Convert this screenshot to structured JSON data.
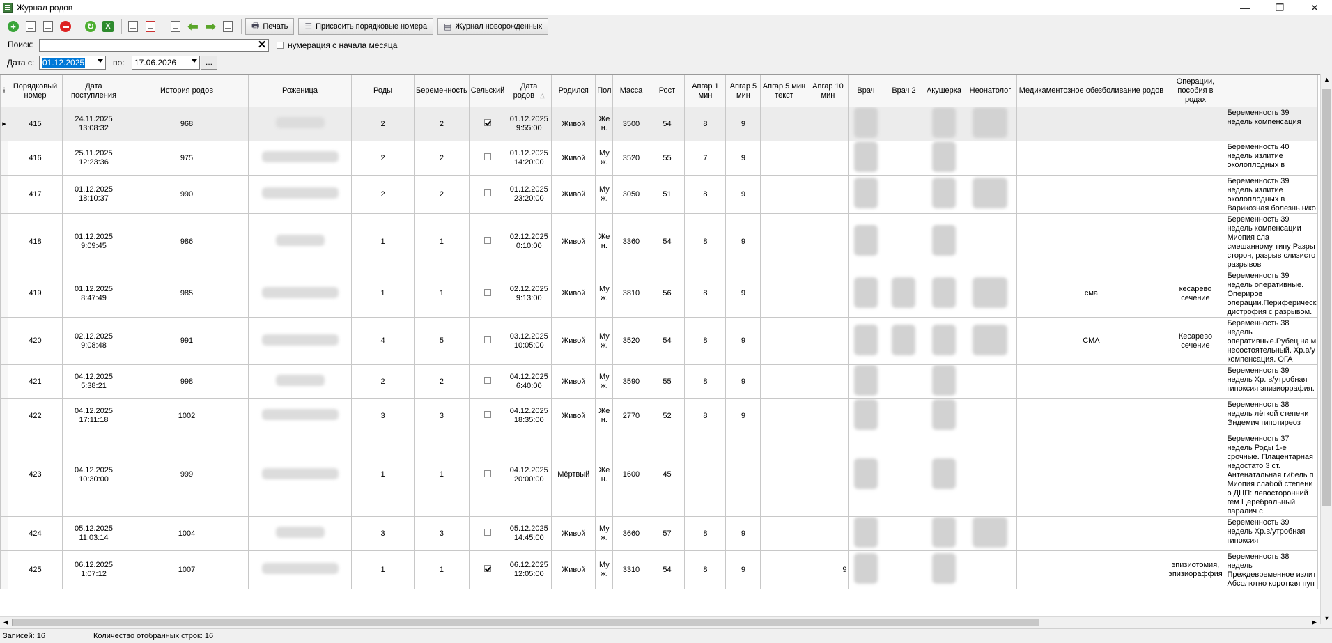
{
  "window": {
    "title": "Журнал родов",
    "minimize": "—",
    "restore": "❐",
    "close": "✕"
  },
  "toolbar": {
    "print_label": "Печать",
    "assign_numbers_label": "Присвоить порядковые номера",
    "newborn_journal_label": "Журнал новорожденных"
  },
  "search": {
    "label": "Поиск:",
    "value": "",
    "clear": "✕"
  },
  "numbering_option": {
    "label": "нумерация с начала месяца",
    "checked": false
  },
  "dates": {
    "from_label": "Дата с:",
    "from_value": "01.12.2025",
    "to_label": "по:",
    "to_value": "17.06.2026",
    "more": "..."
  },
  "columns": [
    "Порядковый номер",
    "Дата поступления",
    "История родов",
    "Роженица",
    "Роды",
    "Беременность",
    "Сельский",
    "Дата родов",
    "Родился",
    "Пол",
    "Масса",
    "Рост",
    "Апгар 1 мин",
    "Апгар 5 мин",
    "Апгар 5 мин текст",
    "Апгар 10 мин",
    "Врач",
    "Врач 2",
    "Акушерка",
    "Неонатолог",
    "Медикаментозное обезболивание родов",
    "Операции, пособия в родах",
    ""
  ],
  "rows": [
    {
      "num": "415",
      "adm": "24.11.2025 13:08:32",
      "hist": "968",
      "births": "2",
      "preg": "2",
      "rural": true,
      "bdate": "01.12.2025 9:55:00",
      "born": "Живой",
      "sex": "Же н.",
      "mass": "3500",
      "height": "54",
      "a1": "8",
      "a5": "9",
      "a10": "",
      "anest": "",
      "ops": "",
      "diag": "Беременность 39 недель компенсация"
    },
    {
      "num": "416",
      "adm": "25.11.2025 12:23:36",
      "hist": "975",
      "births": "2",
      "preg": "2",
      "rural": false,
      "bdate": "01.12.2025 14:20:00",
      "born": "Живой",
      "sex": "Му ж.",
      "mass": "3520",
      "height": "55",
      "a1": "7",
      "a5": "9",
      "a10": "",
      "anest": "",
      "ops": "",
      "diag": "Беременность 40 недель излитие околоплодных в"
    },
    {
      "num": "417",
      "adm": "01.12.2025 18:10:37",
      "hist": "990",
      "births": "2",
      "preg": "2",
      "rural": false,
      "bdate": "01.12.2025 23:20:00",
      "born": "Живой",
      "sex": "Му ж.",
      "mass": "3050",
      "height": "51",
      "a1": "8",
      "a5": "9",
      "a10": "",
      "anest": "",
      "ops": "",
      "diag": "Беременность 39 недель излитие околоплодных в Варикозная болезнь н/ко"
    },
    {
      "num": "418",
      "adm": "01.12.2025 9:09:45",
      "hist": "986",
      "births": "1",
      "preg": "1",
      "rural": false,
      "bdate": "02.12.2025 0:10:00",
      "born": "Живой",
      "sex": "Же н.",
      "mass": "3360",
      "height": "54",
      "a1": "8",
      "a5": "9",
      "a10": "",
      "anest": "",
      "ops": "",
      "diag": "Беременность 39 недель компенсации Миопия сла смешанному типу Разры сторон, разрыв слизисто разрывов"
    },
    {
      "num": "419",
      "adm": "01.12.2025 8:47:49",
      "hist": "985",
      "births": "1",
      "preg": "1",
      "rural": false,
      "bdate": "02.12.2025 9:13:00",
      "born": "Живой",
      "sex": "Му ж.",
      "mass": "3810",
      "height": "56",
      "a1": "8",
      "a5": "9",
      "a10": "",
      "anest": "сма",
      "ops": "кесарево сечение",
      "diag": "Беременность 39 недель оперативные. Опериров операции.Периферическ дистрофия с разрывом."
    },
    {
      "num": "420",
      "adm": "02.12.2025 9:08:48",
      "hist": "991",
      "births": "4",
      "preg": "5",
      "rural": false,
      "bdate": "03.12.2025 10:05:00",
      "born": "Живой",
      "sex": "Му ж.",
      "mass": "3520",
      "height": "54",
      "a1": "8",
      "a5": "9",
      "a10": "",
      "anest": "СМА",
      "ops": "Кесарево сечение",
      "diag": "Беременность 38 недель оперативные.Рубец на м несостоятельный. Хр.в/у компенсация. ОГА"
    },
    {
      "num": "421",
      "adm": "04.12.2025 5:38:21",
      "hist": "998",
      "births": "2",
      "preg": "2",
      "rural": false,
      "bdate": "04.12.2025 6:40:00",
      "born": "Живой",
      "sex": "Му ж.",
      "mass": "3590",
      "height": "55",
      "a1": "8",
      "a5": "9",
      "a10": "",
      "anest": "",
      "ops": "",
      "diag": "Беременность 39 недель Хр. в/утробная гипоксия эпизиоррафия."
    },
    {
      "num": "422",
      "adm": "04.12.2025 17:11:18",
      "hist": "1002",
      "births": "3",
      "preg": "3",
      "rural": false,
      "bdate": "04.12.2025 18:35:00",
      "born": "Живой",
      "sex": "Же н.",
      "mass": "2770",
      "height": "52",
      "a1": "8",
      "a5": "9",
      "a10": "",
      "anest": "",
      "ops": "",
      "diag": "Беременность 38 недель лёгкой степени Эндемич гипотиреоз"
    },
    {
      "num": "423",
      "adm": "04.12.2025 10:30:00",
      "hist": "999",
      "births": "1",
      "preg": "1",
      "rural": false,
      "bdate": "04.12.2025 20:00:00",
      "born": "Мёртвый",
      "sex": "Же н.",
      "mass": "1600",
      "height": "45",
      "a1": "",
      "a5": "",
      "a10": "",
      "anest": "",
      "ops": "",
      "diag": "Беременность 37 недель Роды 1-е срочные. Плацентарная недостато 3 ст. Антенатальная гибель п Миопия слабой степени о ДЦП: левосторонний гем Церебральный паралич с"
    },
    {
      "num": "424",
      "adm": "05.12.2025 11:03:14",
      "hist": "1004",
      "births": "3",
      "preg": "3",
      "rural": false,
      "bdate": "05.12.2025 14:45:00",
      "born": "Живой",
      "sex": "Му ж.",
      "mass": "3660",
      "height": "57",
      "a1": "8",
      "a5": "9",
      "a10": "",
      "anest": "",
      "ops": "",
      "diag": "Беременность 39 недель Хр.в/утробная гипоксия"
    },
    {
      "num": "425",
      "adm": "06.12.2025 1:07:12",
      "hist": "1007",
      "births": "1",
      "preg": "1",
      "rural": true,
      "bdate": "06.12.2025 12:05:00",
      "born": "Живой",
      "sex": "Му ж.",
      "mass": "3310",
      "height": "54",
      "a1": "8",
      "a5": "9",
      "a10": "9",
      "anest": "",
      "ops": "эпизиотомия, эпизиораффия",
      "diag": "Беременность 38 недель Преждевременное излит Абсолютно короткая пуп"
    }
  ],
  "status": {
    "records": "Записей: 16",
    "selected": "Количество отобранных строк: 16"
  }
}
